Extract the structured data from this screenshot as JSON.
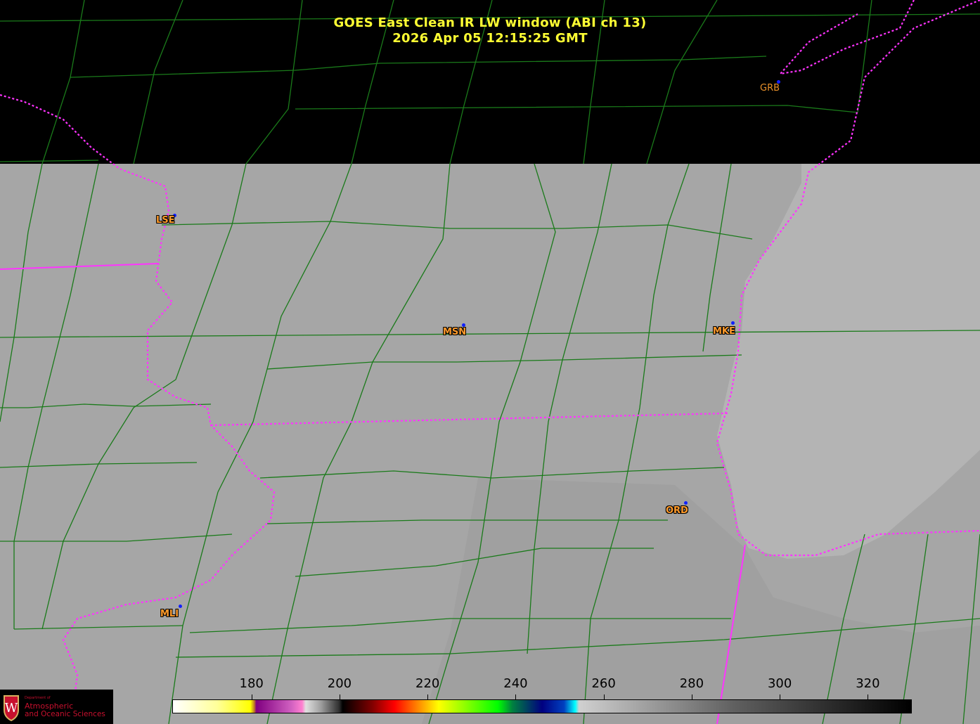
{
  "title": {
    "line1": "GOES East Clean IR LW window (ABI ch 13)",
    "line2": "2026 Apr 05  12:15:25 GMT"
  },
  "stations": [
    {
      "id": "GRB"
    },
    {
      "id": "LSE"
    },
    {
      "id": "MSN"
    },
    {
      "id": "MKE"
    },
    {
      "id": "ORD"
    },
    {
      "id": "MLI"
    }
  ],
  "colorbar": {
    "unit_range": [
      162,
      330
    ],
    "ticks": [
      "180",
      "200",
      "220",
      "240",
      "260",
      "280",
      "300",
      "320"
    ]
  },
  "logo": {
    "dept": "Department of",
    "line1": "Atmospheric",
    "line2": "and Oceanic Sciences"
  },
  "colors": {
    "county_lines": "#1a7a1a",
    "state_lines": "#ff33ff",
    "title": "#ffff33",
    "station_label": "#ff9a2a"
  }
}
